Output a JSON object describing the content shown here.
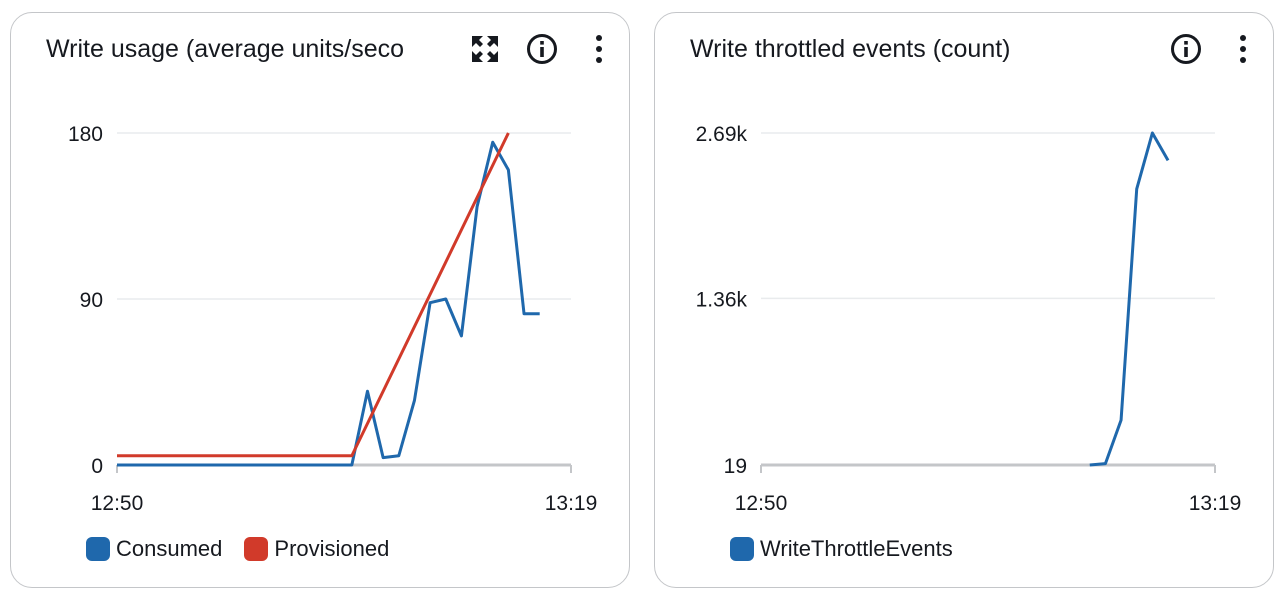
{
  "colors": {
    "consumed": "#1f68ac",
    "provisioned": "#d13a2a",
    "throttle": "#1f68ac",
    "grid": "#e9ebed",
    "baseline": "#c4c6c9"
  },
  "chart_data": [
    {
      "type": "line",
      "title": "Write usage (average units/seco",
      "icons": [
        "expand-icon",
        "info-icon",
        "more-options-icon"
      ],
      "x": [
        "12:50",
        "12:51",
        "12:52",
        "12:53",
        "12:54",
        "12:55",
        "12:56",
        "12:57",
        "12:58",
        "12:59",
        "13:00",
        "13:01",
        "13:02",
        "13:03",
        "13:04",
        "13:05",
        "13:06",
        "13:07",
        "13:08",
        "13:09",
        "13:10",
        "13:11",
        "13:12",
        "13:13",
        "13:14",
        "13:15",
        "13:16",
        "13:17",
        "13:18",
        "13:19"
      ],
      "xticks": [
        "12:50",
        "13:19"
      ],
      "yticks": [
        {
          "value": 0,
          "label": "0"
        },
        {
          "value": 90,
          "label": "90"
        },
        {
          "value": 180,
          "label": "180"
        }
      ],
      "ylim": [
        0,
        180
      ],
      "series": [
        {
          "name": "Consumed",
          "color": "#1f68ac",
          "values": [
            0,
            0,
            0,
            0,
            0,
            0,
            0,
            0,
            0,
            0,
            0,
            0,
            0,
            0,
            0,
            0,
            40,
            4,
            5,
            35,
            88,
            90,
            70,
            140,
            175,
            160,
            82,
            82,
            null,
            null
          ]
        },
        {
          "name": "Provisioned",
          "color": "#d13a2a",
          "values": [
            5,
            5,
            5,
            5,
            5,
            5,
            5,
            5,
            5,
            5,
            5,
            5,
            5,
            5,
            5,
            5,
            null,
            null,
            null,
            null,
            null,
            null,
            null,
            null,
            null,
            180,
            null,
            null,
            null,
            null
          ]
        }
      ]
    },
    {
      "type": "line",
      "title": "Write throttled events (count)",
      "icons": [
        "info-icon",
        "more-options-icon"
      ],
      "x": [
        "12:50",
        "12:51",
        "12:52",
        "12:53",
        "12:54",
        "12:55",
        "12:56",
        "12:57",
        "12:58",
        "12:59",
        "13:00",
        "13:01",
        "13:02",
        "13:03",
        "13:04",
        "13:05",
        "13:06",
        "13:07",
        "13:08",
        "13:09",
        "13:10",
        "13:11",
        "13:12",
        "13:13",
        "13:14",
        "13:15",
        "13:16",
        "13:17",
        "13:18",
        "13:19"
      ],
      "xticks": [
        "12:50",
        "13:19"
      ],
      "yticks": [
        {
          "value": 19,
          "label": "19"
        },
        {
          "value": 1360,
          "label": "1.36k"
        },
        {
          "value": 2690,
          "label": "2.69k"
        }
      ],
      "ylim": [
        19,
        2690
      ],
      "series": [
        {
          "name": "WriteThrottleEvents",
          "color": "#1f68ac",
          "values": [
            null,
            null,
            null,
            null,
            null,
            null,
            null,
            null,
            null,
            null,
            null,
            null,
            null,
            null,
            null,
            null,
            null,
            null,
            null,
            null,
            null,
            19,
            30,
            380,
            2240,
            2690,
            2470,
            null,
            null,
            null
          ]
        }
      ]
    }
  ]
}
